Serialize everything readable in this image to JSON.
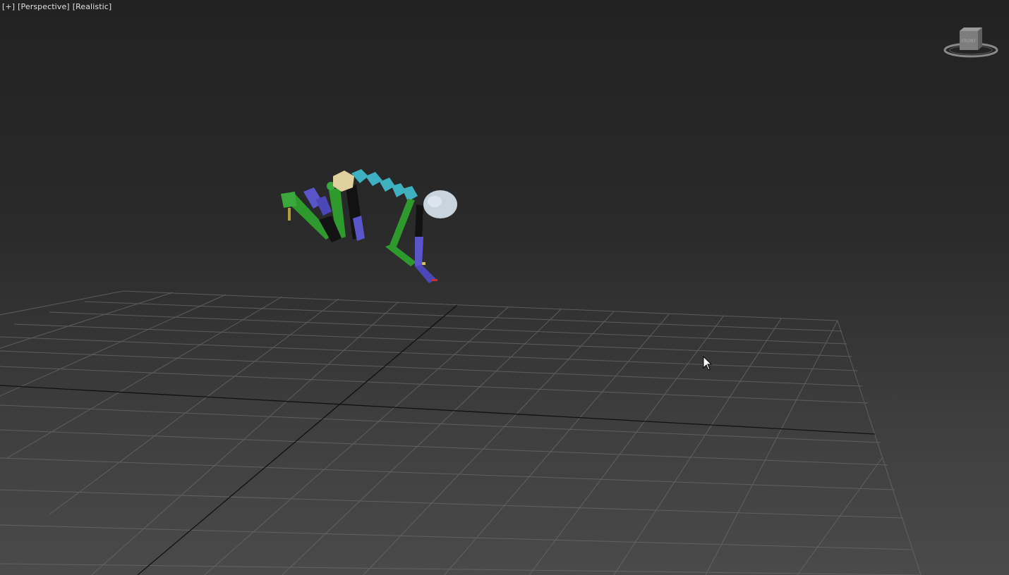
{
  "viewport": {
    "label_plus": "[+]",
    "label_view": "[Perspective]",
    "label_shading": "[Realistic]"
  },
  "viewcube": {
    "face_label": "FRONT"
  },
  "icons": {
    "cursor": "mouse-pointer-icon"
  },
  "colors": {
    "background_top": "#222222",
    "background_bottom": "#4a4a4a",
    "grid_line": "#6a6a6a",
    "grid_axis": "#111111",
    "bone_green": "#2e9a2e",
    "bone_blue": "#5a55c8",
    "bone_cyan": "#3fb0c0",
    "head": "#c8d4de",
    "pelvis": "#e0d0a0"
  }
}
